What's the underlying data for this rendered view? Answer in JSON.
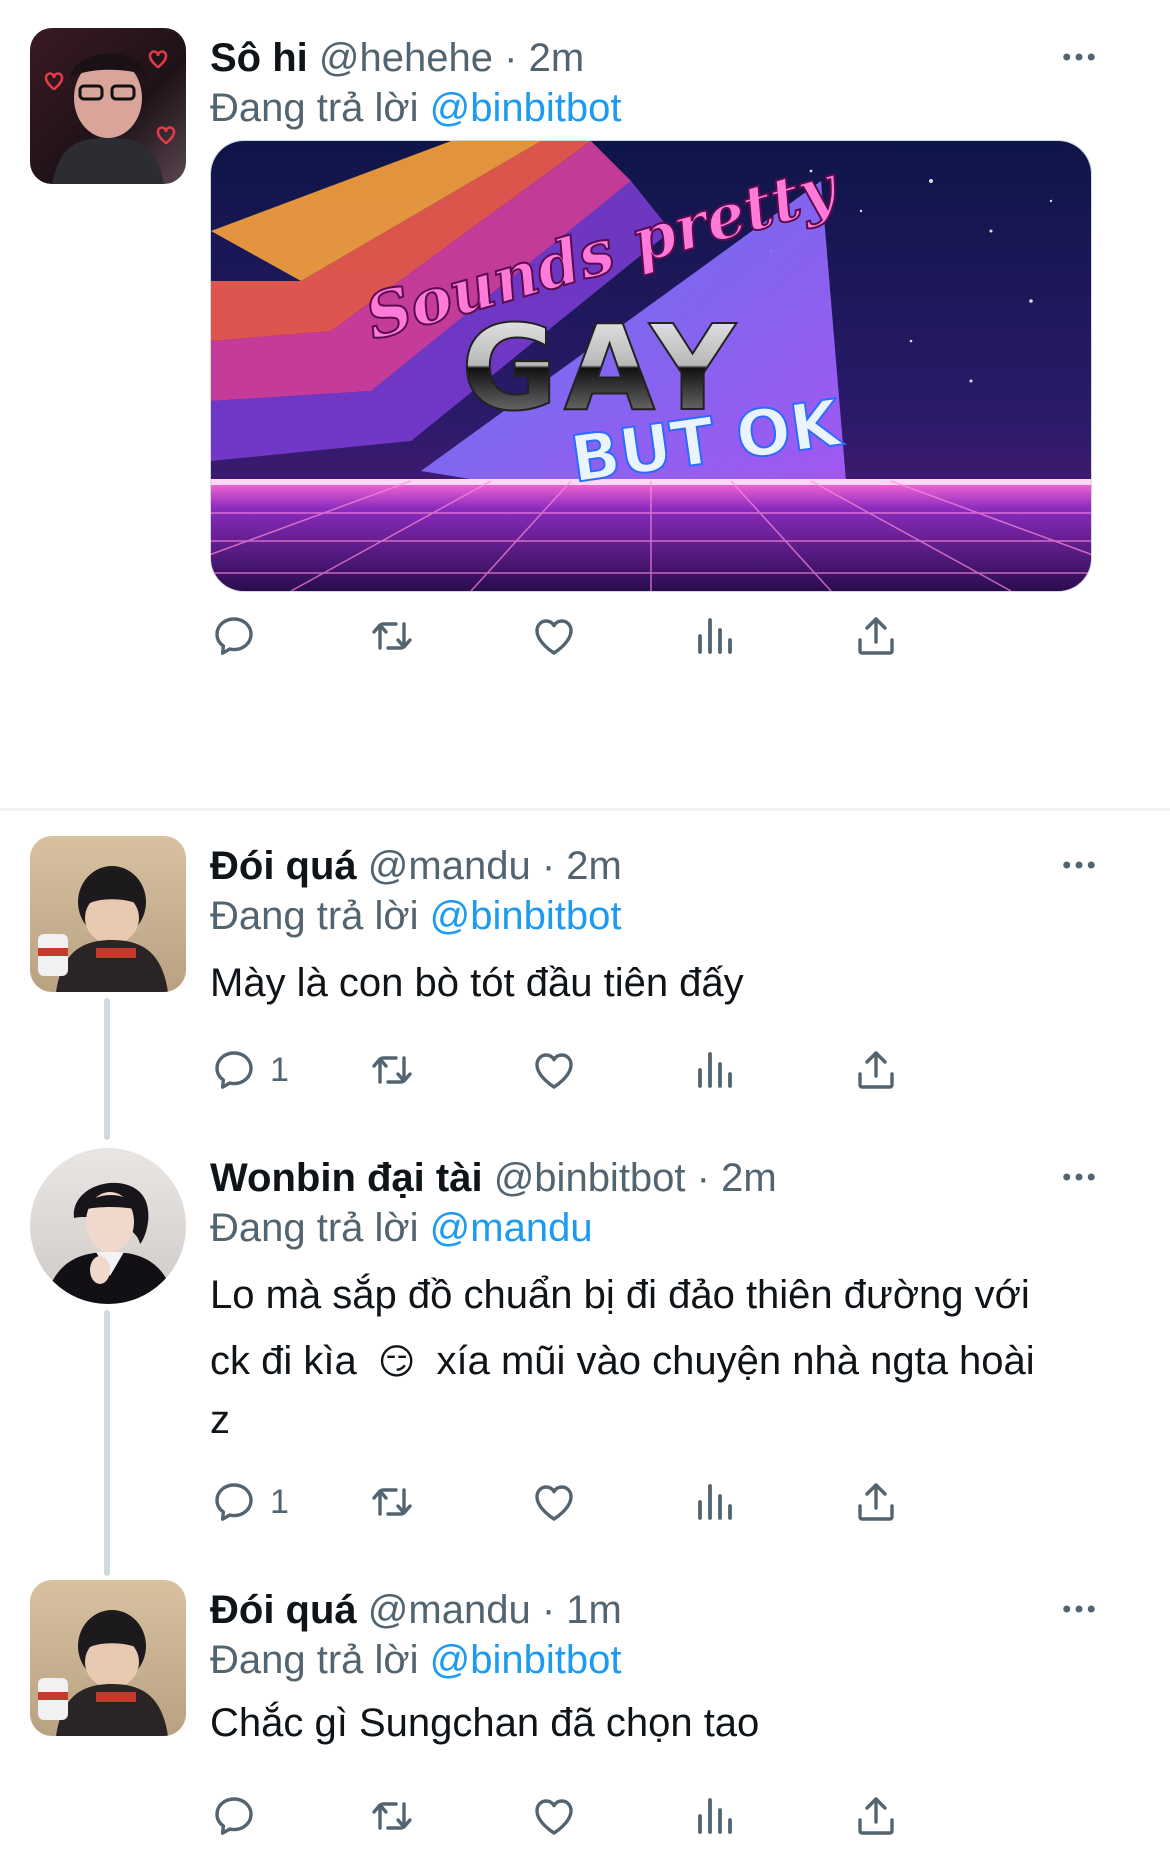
{
  "tweets": [
    {
      "name": "Sô hi",
      "handle": "@hehehe",
      "time": "2m",
      "reply_prefix": "Đang trả lời",
      "reply_to": "@binbitbot",
      "media": {
        "line1": "Sounds pretty",
        "line2": "GAY",
        "line3": "BUT OK"
      },
      "reply_count": "",
      "avatar": "avatar-heart-selfie"
    },
    {
      "name": "Đói quá",
      "handle": "@mandu",
      "time": "2m",
      "reply_prefix": "Đang trả lời",
      "reply_to": "@binbitbot",
      "text": "Mày là con bò tót đầu tiên đấy",
      "reply_count": "1",
      "avatar": "avatar-child-photo"
    },
    {
      "name": "Wonbin đại tài",
      "handle": "@binbitbot",
      "time": "2m",
      "reply_prefix": "Đang trả lời",
      "reply_to": "@mandu",
      "text_line1": "Lo mà sắp đồ chuẩn bị đi đảo thiên đường với",
      "text_line2a": "ck đi kìa",
      "text_emoji": "😏",
      "text_line2b": "xía mũi vào chuyện nhà ngta hoài",
      "text_line3": "z",
      "reply_count": "1",
      "avatar": "avatar-portrait-dark"
    },
    {
      "name": "Đói quá",
      "handle": "@mandu",
      "time": "1m",
      "reply_prefix": "Đang trả lời",
      "reply_to": "@binbitbot",
      "text": "Chắc gì Sungchan đã chọn tao",
      "reply_count": "",
      "avatar": "avatar-child-photo"
    }
  ],
  "separator": "·",
  "icons": [
    "reply-icon",
    "retweet-icon",
    "like-icon",
    "analytics-icon",
    "share-icon",
    "more-icon"
  ],
  "colors": {
    "text": "#0f1419",
    "secondary": "#536471",
    "link": "#1d9bf0",
    "divider": "#eff3f4"
  }
}
